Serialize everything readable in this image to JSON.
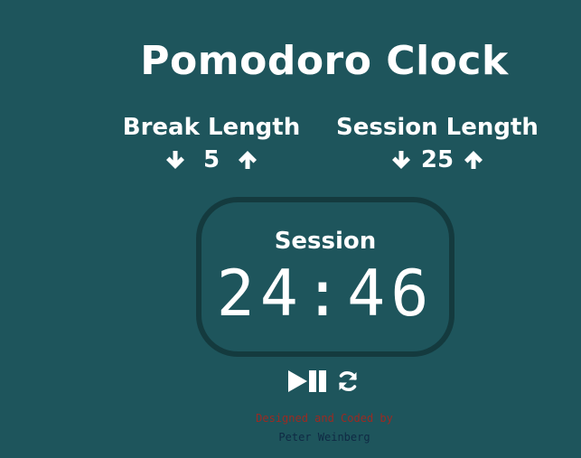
{
  "app": {
    "title": "Pomodoro Clock"
  },
  "break": {
    "label": "Break Length",
    "value": "5",
    "decrement_icon": "arrow-down-icon",
    "increment_icon": "arrow-up-icon"
  },
  "session": {
    "label": "Session Length",
    "value": "25",
    "decrement_icon": "arrow-down-icon",
    "increment_icon": "arrow-up-icon"
  },
  "timer": {
    "label": "Session",
    "time": "24:46"
  },
  "controls": {
    "play_pause_icon": "play-pause-icon",
    "reset_icon": "refresh-icon"
  },
  "credit": {
    "line1": "Designed and Coded by",
    "line2": "Peter Weinberg"
  },
  "colors": {
    "background": "#1e555c",
    "timer_border": "#143a3e",
    "text": "#ffffff",
    "credit_line1": "#9b2a22",
    "credit_line2": "#0f2a44"
  }
}
